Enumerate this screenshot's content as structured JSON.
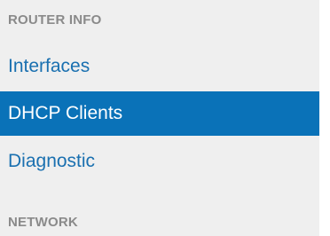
{
  "sidebar": {
    "sections": [
      {
        "header": "ROUTER INFO",
        "items": [
          {
            "label": "Interfaces",
            "active": false
          },
          {
            "label": "DHCP Clients",
            "active": true
          },
          {
            "label": "Diagnostic",
            "active": false
          }
        ]
      },
      {
        "header": "NETWORK",
        "items": []
      }
    ]
  },
  "colors": {
    "background": "#efefef",
    "header_text": "#8a8a8a",
    "link_text": "#1a70b0",
    "active_background": "#0a72b8",
    "active_text": "#ffffff"
  }
}
